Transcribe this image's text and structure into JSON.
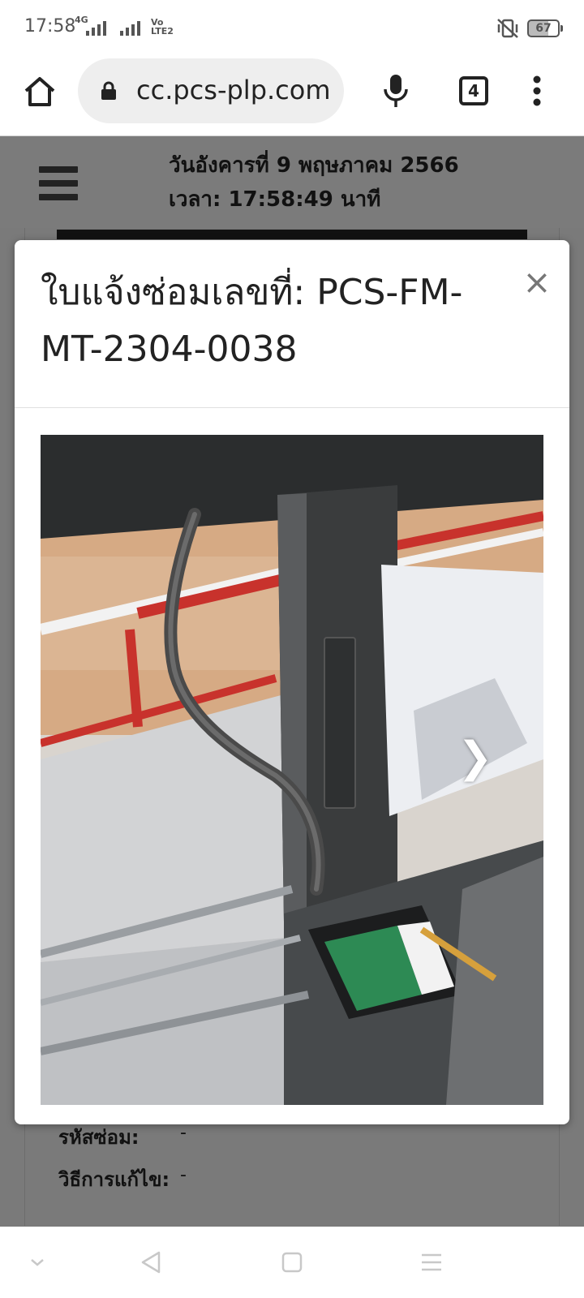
{
  "status_bar": {
    "time": "17:58",
    "network": "4G",
    "volte": "Vo LTE2",
    "battery": "67"
  },
  "browser": {
    "url": "cc.pcs-plp.com",
    "tab_count": "4"
  },
  "page_header": {
    "date": "วันอังคารที่ 9 พฤษภาคม 2566",
    "time": "เวลา: 17:58:49 นาที"
  },
  "background_rows": [
    {
      "label": "รหัสซ่อม:",
      "value": "-"
    },
    {
      "label": "วิธีการแก้ไข:",
      "value": "-"
    }
  ],
  "modal": {
    "title": "ใบแจ้งซ่อมเลขที่: PCS-FM-MT-2304-0038",
    "close_label": "×",
    "next_label": "❯"
  },
  "colors": {
    "overlay": "#7a7a7a",
    "modal_bg": "#ffffff",
    "text_dark": "#222222"
  }
}
